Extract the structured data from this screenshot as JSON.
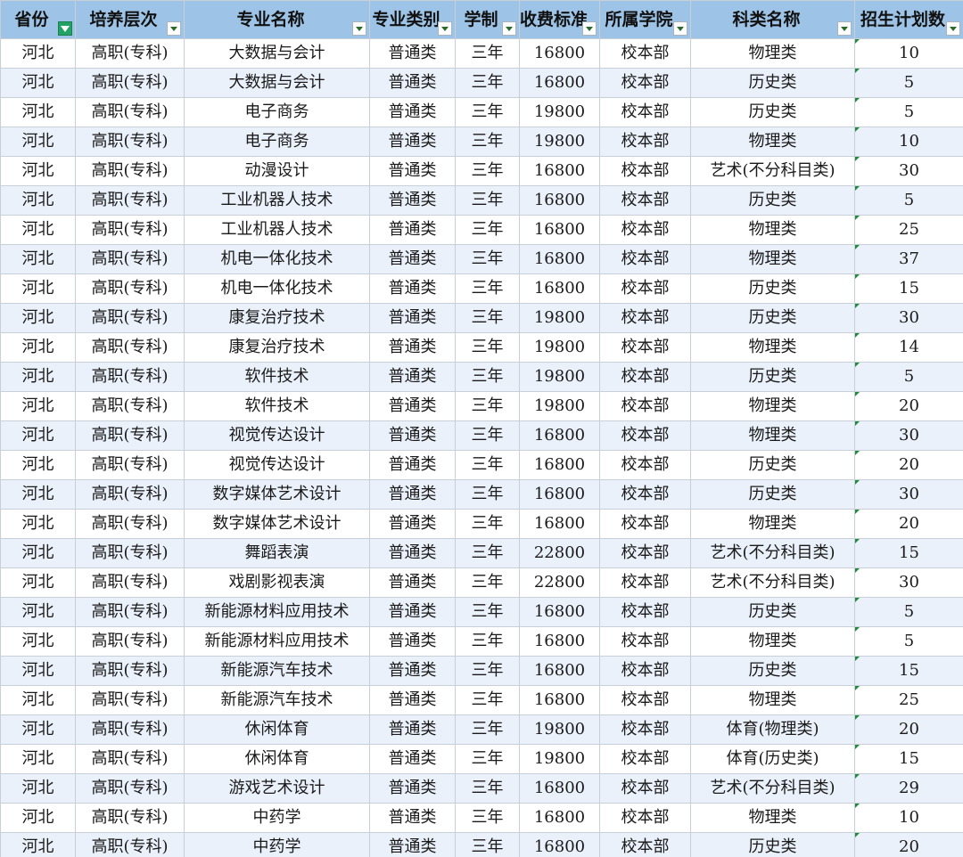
{
  "headers": [
    "省份",
    "培养层次",
    "专业名称",
    "专业类别",
    "学制",
    "收费标准",
    "所属学院",
    "科类名称",
    "招生计划数"
  ],
  "rows": [
    [
      "河北",
      "高职(专科)",
      "大数据与会计",
      "普通类",
      "三年",
      "16800",
      "校本部",
      "物理类",
      "10"
    ],
    [
      "河北",
      "高职(专科)",
      "大数据与会计",
      "普通类",
      "三年",
      "16800",
      "校本部",
      "历史类",
      "5"
    ],
    [
      "河北",
      "高职(专科)",
      "电子商务",
      "普通类",
      "三年",
      "19800",
      "校本部",
      "历史类",
      "5"
    ],
    [
      "河北",
      "高职(专科)",
      "电子商务",
      "普通类",
      "三年",
      "19800",
      "校本部",
      "物理类",
      "10"
    ],
    [
      "河北",
      "高职(专科)",
      "动漫设计",
      "普通类",
      "三年",
      "16800",
      "校本部",
      "艺术(不分科目类)",
      "30"
    ],
    [
      "河北",
      "高职(专科)",
      "工业机器人技术",
      "普通类",
      "三年",
      "16800",
      "校本部",
      "历史类",
      "5"
    ],
    [
      "河北",
      "高职(专科)",
      "工业机器人技术",
      "普通类",
      "三年",
      "16800",
      "校本部",
      "物理类",
      "25"
    ],
    [
      "河北",
      "高职(专科)",
      "机电一体化技术",
      "普通类",
      "三年",
      "16800",
      "校本部",
      "物理类",
      "37"
    ],
    [
      "河北",
      "高职(专科)",
      "机电一体化技术",
      "普通类",
      "三年",
      "16800",
      "校本部",
      "历史类",
      "15"
    ],
    [
      "河北",
      "高职(专科)",
      "康复治疗技术",
      "普通类",
      "三年",
      "19800",
      "校本部",
      "历史类",
      "30"
    ],
    [
      "河北",
      "高职(专科)",
      "康复治疗技术",
      "普通类",
      "三年",
      "19800",
      "校本部",
      "物理类",
      "14"
    ],
    [
      "河北",
      "高职(专科)",
      "软件技术",
      "普通类",
      "三年",
      "19800",
      "校本部",
      "历史类",
      "5"
    ],
    [
      "河北",
      "高职(专科)",
      "软件技术",
      "普通类",
      "三年",
      "19800",
      "校本部",
      "物理类",
      "20"
    ],
    [
      "河北",
      "高职(专科)",
      "视觉传达设计",
      "普通类",
      "三年",
      "16800",
      "校本部",
      "物理类",
      "30"
    ],
    [
      "河北",
      "高职(专科)",
      "视觉传达设计",
      "普通类",
      "三年",
      "16800",
      "校本部",
      "历史类",
      "20"
    ],
    [
      "河北",
      "高职(专科)",
      "数字媒体艺术设计",
      "普通类",
      "三年",
      "16800",
      "校本部",
      "历史类",
      "30"
    ],
    [
      "河北",
      "高职(专科)",
      "数字媒体艺术设计",
      "普通类",
      "三年",
      "16800",
      "校本部",
      "物理类",
      "20"
    ],
    [
      "河北",
      "高职(专科)",
      "舞蹈表演",
      "普通类",
      "三年",
      "22800",
      "校本部",
      "艺术(不分科目类)",
      "15"
    ],
    [
      "河北",
      "高职(专科)",
      "戏剧影视表演",
      "普通类",
      "三年",
      "22800",
      "校本部",
      "艺术(不分科目类)",
      "30"
    ],
    [
      "河北",
      "高职(专科)",
      "新能源材料应用技术",
      "普通类",
      "三年",
      "16800",
      "校本部",
      "历史类",
      "5"
    ],
    [
      "河北",
      "高职(专科)",
      "新能源材料应用技术",
      "普通类",
      "三年",
      "16800",
      "校本部",
      "物理类",
      "5"
    ],
    [
      "河北",
      "高职(专科)",
      "新能源汽车技术",
      "普通类",
      "三年",
      "16800",
      "校本部",
      "历史类",
      "15"
    ],
    [
      "河北",
      "高职(专科)",
      "新能源汽车技术",
      "普通类",
      "三年",
      "16800",
      "校本部",
      "物理类",
      "25"
    ],
    [
      "河北",
      "高职(专科)",
      "休闲体育",
      "普通类",
      "三年",
      "19800",
      "校本部",
      "体育(物理类)",
      "20"
    ],
    [
      "河北",
      "高职(专科)",
      "休闲体育",
      "普通类",
      "三年",
      "19800",
      "校本部",
      "体育(历史类)",
      "15"
    ],
    [
      "河北",
      "高职(专科)",
      "游戏艺术设计",
      "普通类",
      "三年",
      "16800",
      "校本部",
      "艺术(不分科目类)",
      "29"
    ],
    [
      "河北",
      "高职(专科)",
      "中药学",
      "普通类",
      "三年",
      "16800",
      "校本部",
      "物理类",
      "10"
    ],
    [
      "河北",
      "高职(专科)",
      "中药学",
      "普通类",
      "三年",
      "16800",
      "校本部",
      "历史类",
      "20"
    ]
  ],
  "filter_active_column": 0,
  "colors": {
    "header_bg": "#9dc3e6",
    "band": "#eaf1fb",
    "filter_active": "#21a366",
    "cell_marker": "#1e8a3c"
  }
}
